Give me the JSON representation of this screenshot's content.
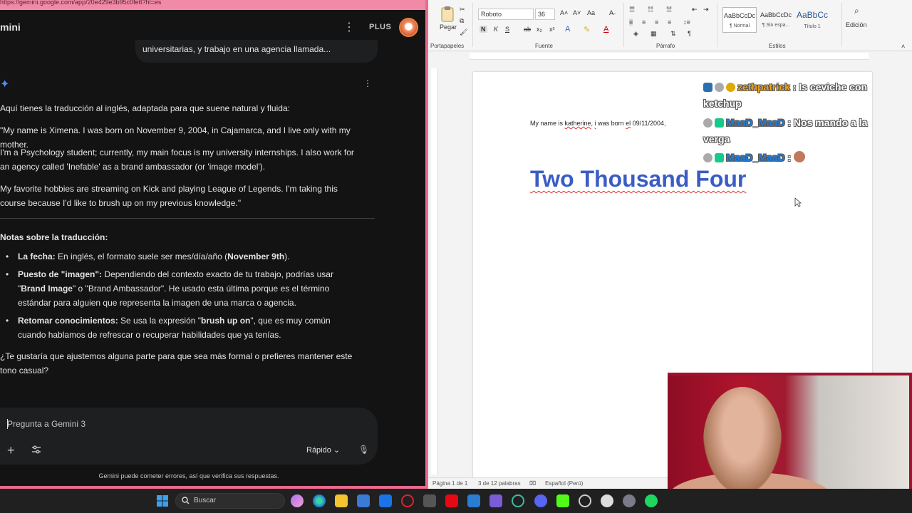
{
  "browser": {
    "url": "https://gemini.google.com/app/20e429e3b95c0fe6?hl=es",
    "app_title": "mini",
    "plan_badge": "PLUS"
  },
  "conversation": {
    "user_message": "universitarias, y trabajo en una agencia llamada...",
    "intro": "Aquí tienes la traducción al inglés, adaptada para que suene natural y fluida:",
    "paragraphs": [
      "\"My name is Ximena. I was born on November 9, 2004, in Cajamarca, and I live only with my mother.",
      "I'm a Psychology student; currently, my main focus is my university internships. I also work for an agency called 'Inefable' as a brand ambassador (or 'image model').",
      "My favorite hobbies are streaming on Kick and playing League of Legends. I'm taking this course because I'd like to brush up on my previous knowledge.\""
    ],
    "notes_title": "Notas sobre la traducción:",
    "notes": [
      {
        "label": "La fecha:",
        "text": " En inglés, el formato suele ser mes/día/año (",
        "bold_tail": "November 9th",
        "end": ")."
      },
      {
        "label": "Puesto de \"imagen\":",
        "text": " Dependiendo del contexto exacto de tu trabajo, podrías usar \"",
        "bold_tail": "Brand Image",
        "end": "\" o \"Brand Ambassador\". He usado esta última porque es el término estándar para alguien que representa la imagen de una marca o agencia."
      },
      {
        "label": "Retomar conocimientos:",
        "text": " Se usa la expresión \"",
        "bold_tail": "brush up on",
        "end": "\", que es muy común cuando hablamos de refrescar o recuperar habilidades que ya tenías."
      }
    ],
    "closing": "¿Te gustaría que ajustemos alguna parte para que sea más formal o prefieres mantener este tono casual?"
  },
  "composer": {
    "placeholder": "Pregunta a Gemini 3",
    "mode": "Rápido",
    "disclaimer": "Gemini puede cometer errores, así que verifica sus respuestas."
  },
  "word": {
    "ribbon": {
      "paste_label": "Pegar",
      "clipboard_group": "Portapapeles",
      "font_group": "Fuente",
      "paragraph_group": "Párrafo",
      "styles_group": "Estilos",
      "editing_label": "Edición",
      "font_name": "Roboto",
      "font_size": "36",
      "styles": [
        {
          "sample": "AaBbCcDc",
          "name": "¶ Normal"
        },
        {
          "sample": "AaBbCcDc",
          "name": "¶ Sin espa..."
        },
        {
          "sample": "AaBbCc",
          "name": "Título 1"
        }
      ]
    },
    "document": {
      "line_parts": [
        "My name is ",
        "katherine",
        ", ",
        "i",
        " was born ",
        "el",
        " 09/11/2004,"
      ],
      "heading": "Two Thousand Four"
    },
    "status": {
      "page": "Página 1 de 1",
      "words": "3 de 12 palabras",
      "language": "Español (Perú)"
    }
  },
  "chat_overlay": [
    {
      "user": "zethpatrick",
      "message": ": Is ceviche con ketchup"
    },
    {
      "user": "MaaD_MaaD",
      "message": ": Nos mando a la verga"
    },
    {
      "user": "MaaD_MaaD",
      "message": ":"
    }
  ],
  "taskbar": {
    "search_placeholder": "Buscar"
  },
  "colors": {
    "gemini_bg": "#131314",
    "window_border": "#e96a8d",
    "heading_blue": "#3a5cc6",
    "chat_user_gold": "#f0a31a",
    "chat_user_blue": "#1e7fe0"
  }
}
